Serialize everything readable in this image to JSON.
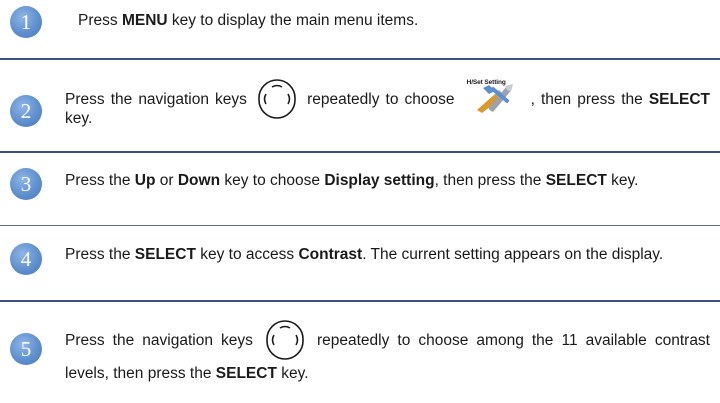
{
  "steps": [
    {
      "number": "1",
      "parts": [
        "Press ",
        "MENU",
        " key to display the main menu items."
      ]
    },
    {
      "number": "2",
      "parts": [
        "Press the navigation keys",
        "repeatedly to choose",
        ", then press the ",
        "SELECT",
        " key."
      ],
      "nav_icon": "navigation-key-icon",
      "menu_icon": "tools-icon",
      "menu_icon_label": "H/Set Setting"
    },
    {
      "number": "3",
      "parts": [
        "Press the ",
        "Up",
        " or ",
        "Down",
        " key to choose ",
        "Display setting",
        ", then press the ",
        "SELECT",
        " key."
      ]
    },
    {
      "number": "4",
      "parts": [
        "Press the ",
        "SELECT",
        " key to access ",
        "Contrast",
        ". The current setting appears on the display."
      ]
    },
    {
      "number": "5",
      "parts": [
        "Press the navigation keys",
        "repeatedly to choose among the 11 available contrast levels, then press the ",
        "SELECT",
        " key."
      ],
      "nav_icon": "navigation-key-icon"
    }
  ],
  "colors": {
    "badge": "#5e8fcf",
    "divider": "#3a4f7a"
  }
}
